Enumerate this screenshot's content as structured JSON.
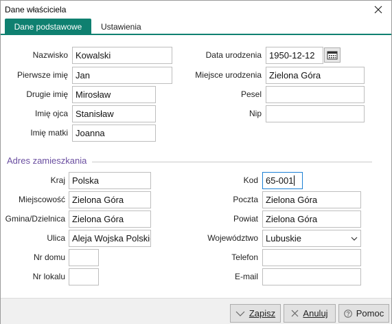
{
  "window": {
    "title": "Dane właściciela"
  },
  "tabs": [
    {
      "label": "Dane podstawowe",
      "active": true
    },
    {
      "label": "Ustawienia",
      "active": false
    }
  ],
  "personal": {
    "nazwisko": {
      "label": "Nazwisko",
      "value": "Kowalski"
    },
    "pierwsze_imie": {
      "label": "Pierwsze imię",
      "value": "Jan"
    },
    "drugie_imie": {
      "label": "Drugie imię",
      "value": "Mirosław"
    },
    "imie_ojca": {
      "label": "Imię ojca",
      "value": "Stanisław"
    },
    "imie_matki": {
      "label": "Imię matki",
      "value": "Joanna"
    },
    "data_urodzenia": {
      "label": "Data urodzenia",
      "value": "1950-12-12"
    },
    "miejsce_urodzenia": {
      "label": "Miejsce urodzenia",
      "value": "Zielona Góra"
    },
    "pesel": {
      "label": "Pesel",
      "value": ""
    },
    "nip": {
      "label": "Nip",
      "value": ""
    }
  },
  "address": {
    "section_title": "Adres zamieszkania",
    "kraj": {
      "label": "Kraj",
      "value": "Polska"
    },
    "miejscowosc": {
      "label": "Miejscowość",
      "value": "Zielona Góra"
    },
    "gmina": {
      "label": "Gmina/Dzielnica",
      "value": "Zielona Góra"
    },
    "ulica": {
      "label": "Ulica",
      "value": "Aleja Wojska Polskie"
    },
    "nr_domu": {
      "label": "Nr domu",
      "value": ""
    },
    "nr_lokalu": {
      "label": "Nr lokalu",
      "value": ""
    },
    "kod": {
      "label": "Kod",
      "value": "65-001"
    },
    "poczta": {
      "label": "Poczta",
      "value": "Zielona Góra"
    },
    "powiat": {
      "label": "Powiat",
      "value": "Zielona Góra"
    },
    "wojewodztwo": {
      "label": "Województwo",
      "value": "Lubuskie"
    },
    "telefon": {
      "label": "Telefon",
      "value": ""
    },
    "email": {
      "label": "E-mail",
      "value": ""
    }
  },
  "footer": {
    "save_label": "Zapisz",
    "cancel_label": "Anuluj",
    "help_label": "Pomoc"
  },
  "colors": {
    "accent": "#0f8070",
    "section_title": "#6a4ea0",
    "focus_border": "#1a7fd4"
  }
}
